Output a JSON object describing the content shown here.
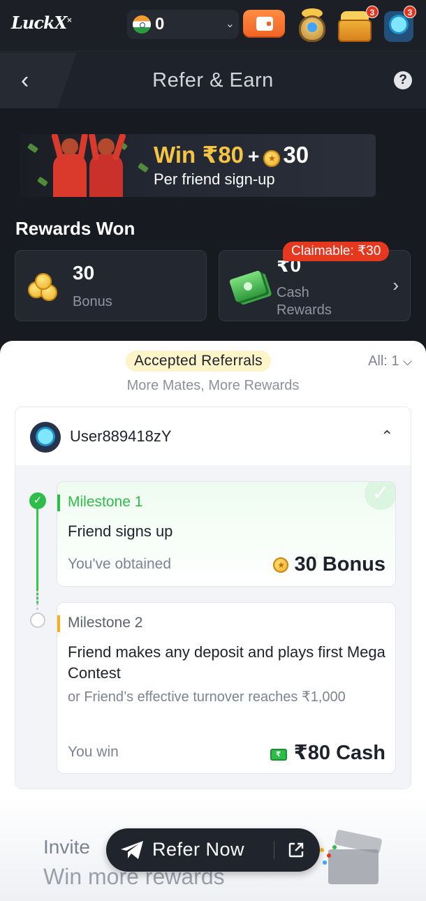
{
  "app": {
    "logo": "LuckX",
    "currency_symbol": "₹"
  },
  "topbar": {
    "balance": "0",
    "chest_badge": "3",
    "avatar_badge": "3"
  },
  "header": {
    "title": "Refer & Earn"
  },
  "banner": {
    "win_amount": "Win ₹80",
    "plus": "+",
    "coin_amount": "30",
    "subtitle": "Per friend sign-up"
  },
  "rewards": {
    "heading": "Rewards Won",
    "bonus": {
      "value": "30",
      "label": "Bonus"
    },
    "cash": {
      "value": "₹0",
      "label": "Cash Rewards",
      "claimable": "Claimable: ₹30"
    }
  },
  "referrals": {
    "pill": "Accepted Referrals",
    "filter": "All: 1",
    "subtitle": "More Mates, More Rewards",
    "user": "User889418zY",
    "milestones": [
      {
        "title": "Milestone 1",
        "description": "Friend signs up",
        "foot_label": "You've obtained",
        "reward": "30 Bonus",
        "status": "completed"
      },
      {
        "title": "Milestone 2",
        "description": "Friend makes any deposit and plays first Mega Contest",
        "note": "or Friend’s effective turnover reaches ₹1,000",
        "foot_label": "You win",
        "reward": "₹80 Cash",
        "status": "pending"
      }
    ]
  },
  "cta": {
    "invite_text": "Invite",
    "invite_sub": "Win more rewards",
    "button": "Refer Now"
  },
  "colors": {
    "accent_green": "#2ebd48",
    "accent_orange": "#f06323",
    "claim_red": "#e5381f",
    "gold": "#f5c443"
  }
}
